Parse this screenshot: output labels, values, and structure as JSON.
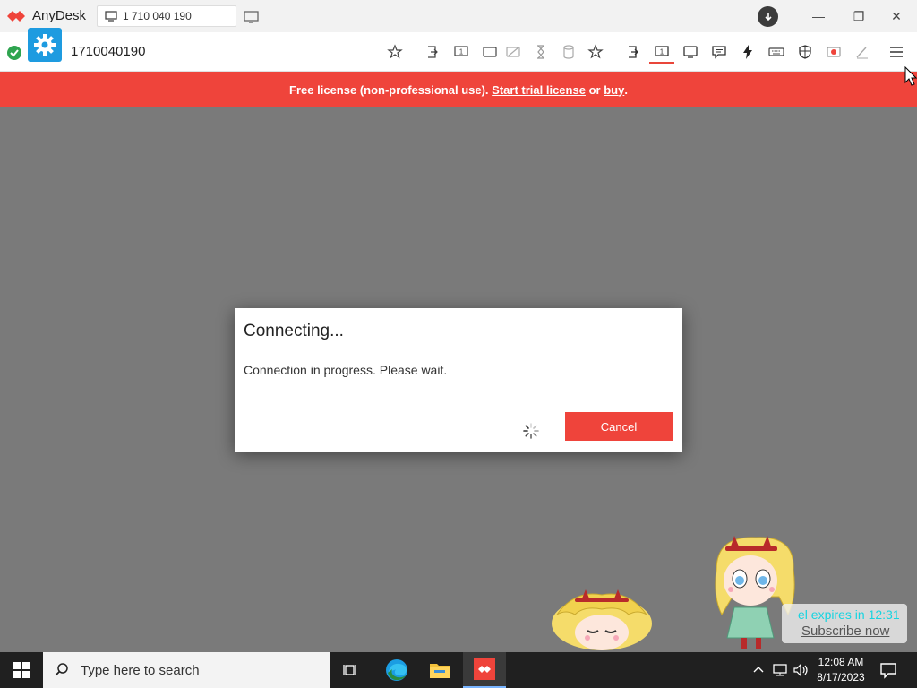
{
  "app": {
    "name": "AnyDesk",
    "tab_label": "1 710 040 190",
    "remote_id": "1710040190",
    "brand_color": "#ef443b",
    "gear_color": "#1e9be0"
  },
  "window_controls": {
    "minimize": "—",
    "restore": "❐",
    "close": "✕"
  },
  "banner": {
    "prefix": "Free license (non-professional use). ",
    "trial_link": "Start trial license",
    "middle": " or ",
    "buy_link": "buy",
    "suffix": "."
  },
  "dialog": {
    "title": "Connecting...",
    "message": "Connection in progress. Please wait.",
    "cancel_label": "Cancel"
  },
  "promo": {
    "line1": "el expires in 12:31",
    "line2": "Subscribe now"
  },
  "taskbar": {
    "search_placeholder": "Type here to search",
    "time": "12:08 AM",
    "date": "8/17/2023"
  },
  "toolbar_icons": [
    "star-icon",
    "exit-icon",
    "monitor-1-icon",
    "window-icon",
    "hidden-screen-icon",
    "hourglass-icon",
    "database-icon",
    "star-icon",
    "exit-icon",
    "monitor-1-icon",
    "display-icon",
    "chat-icon",
    "lightning-icon",
    "keyboard-icon",
    "shield-icon",
    "record-icon",
    "pen-icon",
    "menu-icon"
  ]
}
